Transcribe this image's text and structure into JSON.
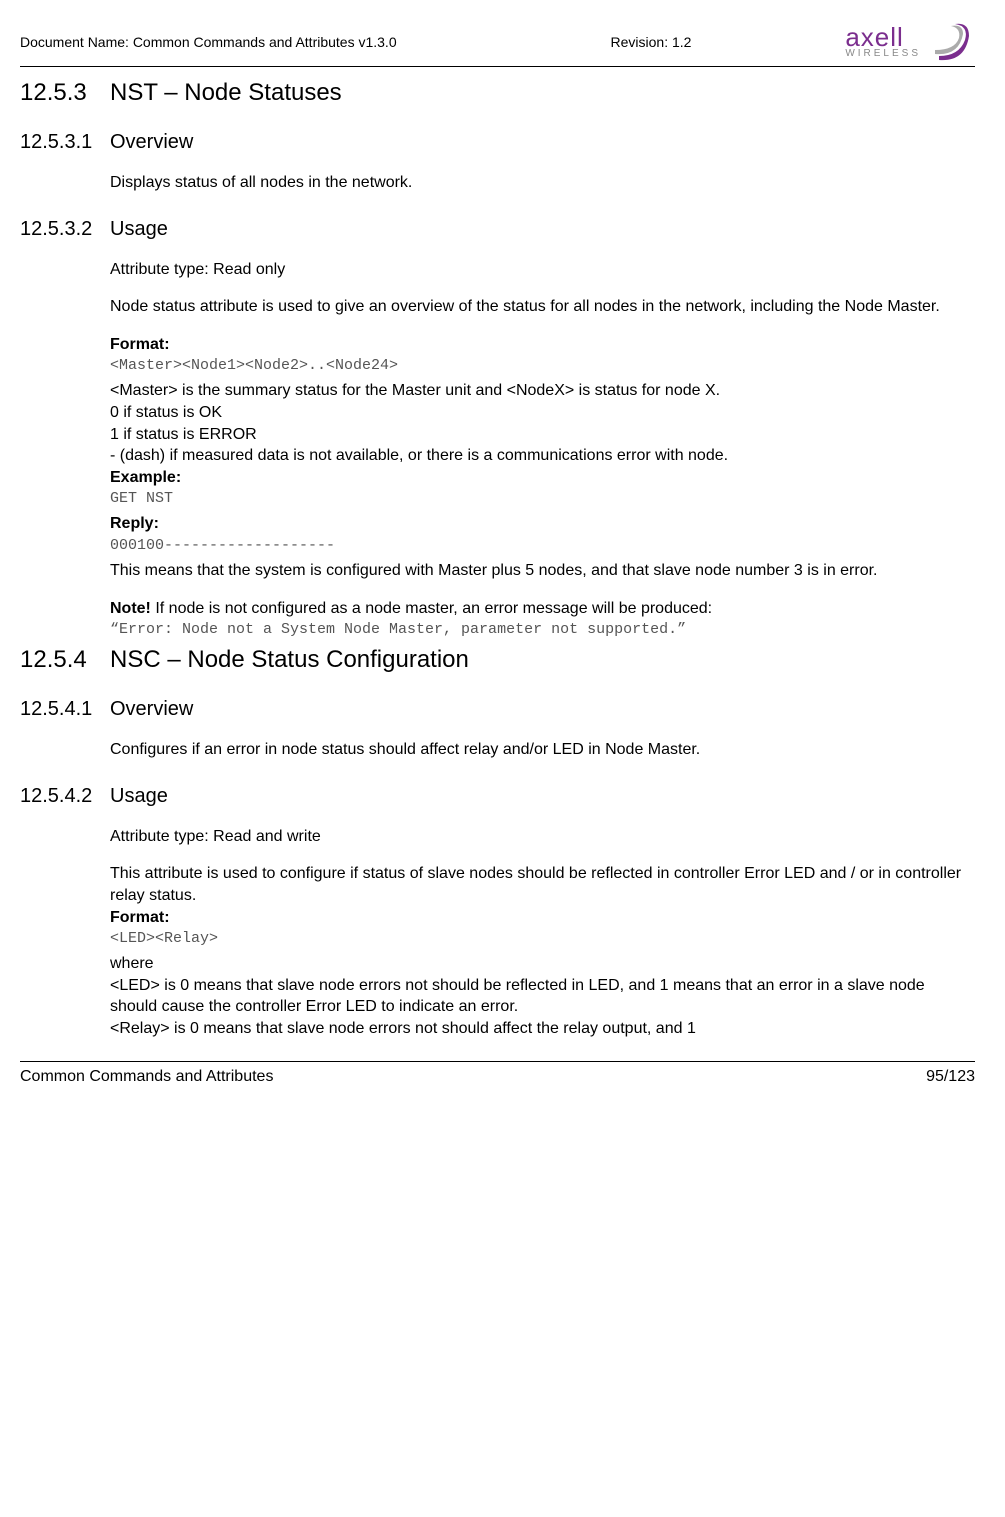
{
  "header": {
    "doc_name": "Document Name: Common Commands and Attributes v1.3.0",
    "revision": "Revision: 1.2",
    "logo_text": "axell",
    "logo_sub": "WIRELESS"
  },
  "s1": {
    "num": "12.5.3",
    "title": "NST – Node Statuses"
  },
  "s1_1": {
    "num": "12.5.3.1",
    "title": "Overview",
    "p1": "Displays status of all nodes in the network."
  },
  "s1_2": {
    "num": "12.5.3.2",
    "title": "Usage",
    "p1": "Attribute type: Read only",
    "p2": "Node status attribute is used to give an overview of the status for all nodes in the network, including the Node Master.",
    "format_label": "Format:",
    "format_code": "<Master><Node1><Node2>..<Node24>",
    "p3a": "<Master> is the summary status for the Master unit and <NodeX> is status for node X.",
    "p3b": "0 if status is OK",
    "p3c": "1 if status is ERROR",
    "p3d": "- (dash) if measured data is not available, or there is a communications error with node.",
    "example_label": "Example:",
    "example_code": "GET NST",
    "reply_label": "Reply:",
    "reply_code": "000100-------------------",
    "p4": "This means that the system is configured with Master plus 5 nodes, and that slave node number 3 is in error.",
    "note_bold": "Note!",
    "note_rest": " If node is not configured as a node master, an error message will be produced:",
    "note_code": "“Error: Node not a System Node Master, parameter not supported.”"
  },
  "s2": {
    "num": "12.5.4",
    "title": "NSC – Node Status Configuration"
  },
  "s2_1": {
    "num": "12.5.4.1",
    "title": "Overview",
    "p1": "Configures if an error in node status should affect relay and/or LED in Node Master."
  },
  "s2_2": {
    "num": "12.5.4.2",
    "title": "Usage",
    "p1": "Attribute type: Read and write",
    "p2": "This attribute is used to configure if status of slave nodes should be reflected in controller Error LED and / or in controller relay status.",
    "format_label": "Format:",
    "format_code": "<LED><Relay>",
    "p3a": "where",
    "p3b": "<LED> is 0 means that slave node errors not should be reflected in LED, and 1 means that an error in a slave node should cause the controller Error LED to indicate an error.",
    "p3c": "<Relay> is 0 means that slave node errors not should affect the relay output, and 1"
  },
  "footer": {
    "left": "Common Commands and Attributes",
    "right": "95/123"
  }
}
